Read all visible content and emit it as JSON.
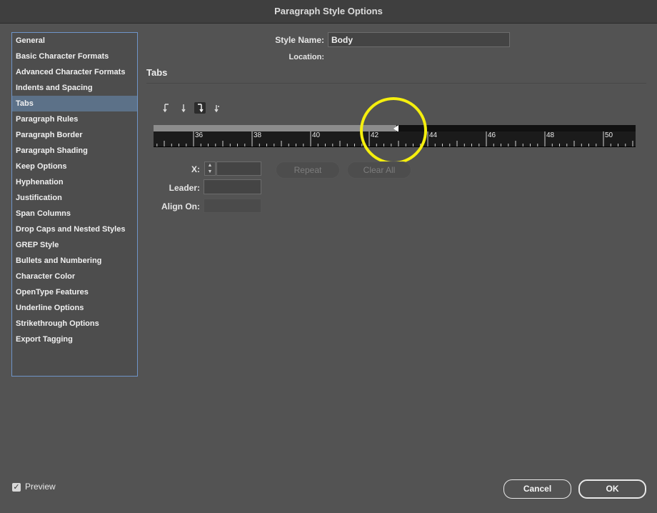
{
  "window": {
    "title": "Paragraph Style Options"
  },
  "sidebar": {
    "items": [
      {
        "label": "General"
      },
      {
        "label": "Basic Character Formats"
      },
      {
        "label": "Advanced Character Formats"
      },
      {
        "label": "Indents and Spacing"
      },
      {
        "label": "Tabs"
      },
      {
        "label": "Paragraph Rules"
      },
      {
        "label": "Paragraph Border"
      },
      {
        "label": "Paragraph Shading"
      },
      {
        "label": "Keep Options"
      },
      {
        "label": "Hyphenation"
      },
      {
        "label": "Justification"
      },
      {
        "label": "Span Columns"
      },
      {
        "label": "Drop Caps and Nested Styles"
      },
      {
        "label": "GREP Style"
      },
      {
        "label": "Bullets and Numbering"
      },
      {
        "label": "Character Color"
      },
      {
        "label": "OpenType Features"
      },
      {
        "label": "Underline Options"
      },
      {
        "label": "Strikethrough Options"
      },
      {
        "label": "Export Tagging"
      }
    ],
    "active": "Tabs"
  },
  "header": {
    "style_name_label": "Style Name:",
    "style_name_value": "Body",
    "location_label": "Location:"
  },
  "tabs_section": {
    "title": "Tabs",
    "tab_types": [
      "left-justified-tab-icon",
      "center-justified-tab-icon",
      "right-justified-tab-icon",
      "align-to-decimal-tab-icon"
    ],
    "selected_tab_type": "right-justified-tab-icon",
    "ruler_labels": [
      "36",
      "38",
      "40",
      "42",
      "44",
      "46",
      "48",
      "50"
    ],
    "x_label": "X:",
    "x_value": "",
    "leader_label": "Leader:",
    "leader_value": "",
    "align_on_label": "Align On:",
    "align_on_value": "",
    "repeat_label": "Repeat",
    "clear_all_label": "Clear All"
  },
  "footer": {
    "preview_label": "Preview",
    "preview_checked": true,
    "cancel_label": "Cancel",
    "ok_label": "OK"
  },
  "colors": {
    "background": "#535353",
    "sidebar_active": "#5c7188",
    "sidebar_border": "#6f95c8",
    "highlight_ring": "#f5ef0e"
  }
}
